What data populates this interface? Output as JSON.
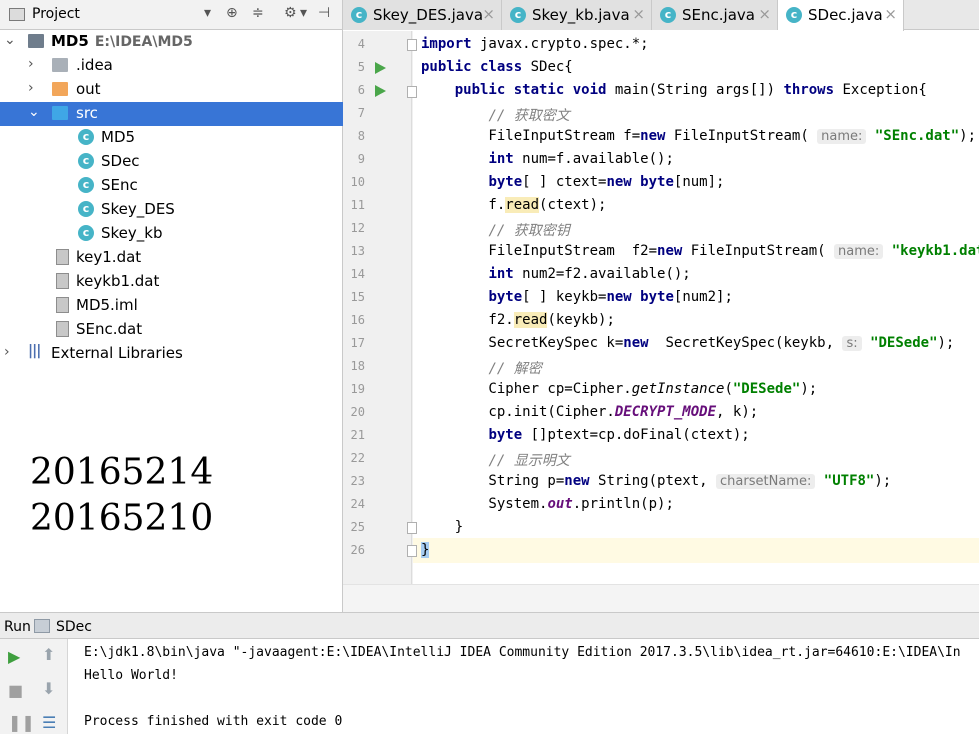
{
  "project_panel": {
    "title": "Project",
    "tree": [
      {
        "label": "MD5",
        "hint": "E:\\IDEA\\MD5"
      },
      {
        "label": ".idea"
      },
      {
        "label": "out"
      },
      {
        "label": "src"
      },
      {
        "label": "MD5"
      },
      {
        "label": "SDec"
      },
      {
        "label": "SEnc"
      },
      {
        "label": "Skey_DES"
      },
      {
        "label": "Skey_kb"
      },
      {
        "label": "key1.dat"
      },
      {
        "label": "keykb1.dat"
      },
      {
        "label": "MD5.iml"
      },
      {
        "label": "SEnc.dat"
      },
      {
        "label": "External Libraries"
      }
    ],
    "handwritten": [
      "20165214",
      "20165210"
    ]
  },
  "tabs": [
    {
      "label": "Skey_DES.java",
      "active": false
    },
    {
      "label": "Skey_kb.java",
      "active": false
    },
    {
      "label": "SEnc.java",
      "active": false
    },
    {
      "label": "SDec.java",
      "active": true
    }
  ],
  "editor": {
    "line_numbers": [
      "4",
      "5",
      "6",
      "7",
      "8",
      "9",
      "10",
      "11",
      "12",
      "13",
      "14",
      "15",
      "16",
      "17",
      "18",
      "19",
      "20",
      "21",
      "22",
      "23",
      "24",
      "25",
      "26"
    ],
    "hints": {
      "name1": "name:",
      "name2": "name:",
      "s": "s:",
      "charset": "charsetName:"
    },
    "strings": {
      "senc": "\"SEnc.dat\"",
      "keykb": "\"keykb1.dat\"",
      "desede1": "\"DESede\"",
      "desede2": "\"DESede\"",
      "utf8": "\"UTF8\""
    },
    "comments": {
      "c1": "// 获取密文",
      "c2": "// 获取密钥",
      "c3": "// 解密",
      "c4": "// 显示明文"
    }
  },
  "run_panel": {
    "label": "Run",
    "config": "SDec",
    "console": [
      "E:\\jdk1.8\\bin\\java \"-javaagent:E:\\IDEA\\IntelliJ IDEA Community Edition 2017.3.5\\lib\\idea_rt.jar=64610:E:\\IDEA\\In",
      "Hello World!",
      "",
      "Process finished with exit code 0"
    ]
  }
}
